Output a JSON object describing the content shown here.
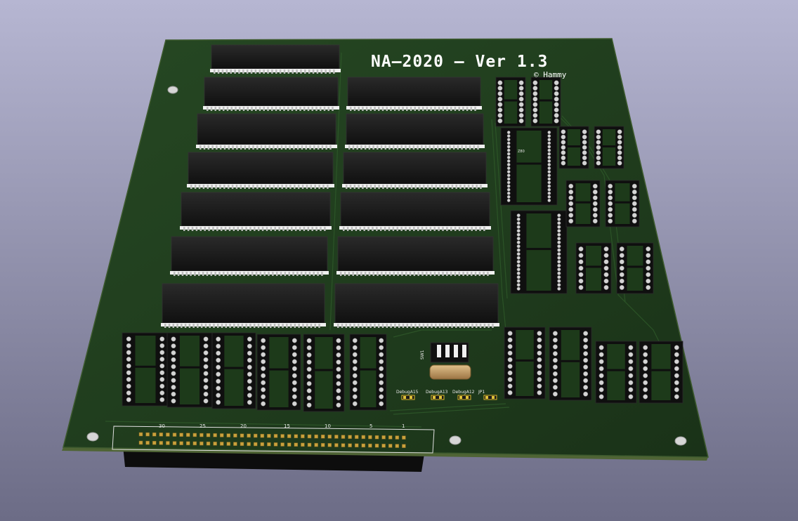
{
  "board": {
    "title": "NA—2020 — Ver 1.3",
    "copyright": "© Hammy",
    "colors": {
      "background_top": "#b4b4d0",
      "background_bottom": "#6e6e86",
      "pcb": "#1f3a1c",
      "pcb_edge": "#5a6e3a",
      "ic_body": "#151515",
      "pin": "#c8c8c8",
      "socket": "#0e0e0e",
      "crystal": "#c9a36a",
      "jumper": "#d9b62a",
      "header_pin": "#c9a13c"
    }
  },
  "silkscreen": {
    "chip_label": "Z80",
    "dip_switch_label": "SW1",
    "jumpers": [
      "DebugA15",
      "DebugA13",
      "DebugA12",
      "JP1"
    ],
    "connector_numbers": [
      "30",
      "25",
      "20",
      "15",
      "10",
      "5",
      "1"
    ]
  }
}
